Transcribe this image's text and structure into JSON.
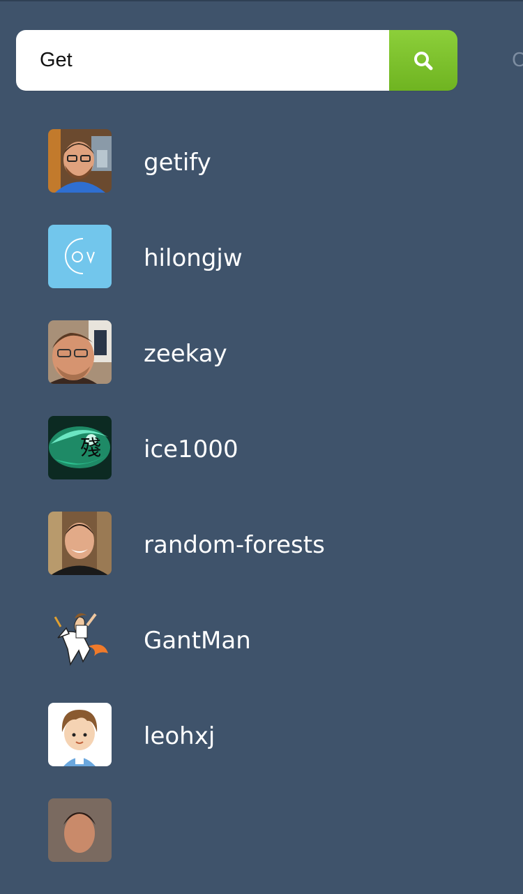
{
  "search": {
    "query": "Get",
    "button_icon": "search-icon",
    "cancel_partial": "C"
  },
  "users": [
    {
      "name": "getify",
      "avatar": "photo-man-beard-glasses"
    },
    {
      "name": "hilongjw",
      "avatar": "logo-ov-circle"
    },
    {
      "name": "zeekay",
      "avatar": "photo-man-glasses"
    },
    {
      "name": "ice1000",
      "avatar": "illustration-green-fish"
    },
    {
      "name": "random-forests",
      "avatar": "photo-man-smiling"
    },
    {
      "name": "GantMan",
      "avatar": "cartoon-unicorn-rider"
    },
    {
      "name": "leohxj",
      "avatar": "cartoon-boy"
    },
    {
      "name": "",
      "avatar": "photo-man-partial"
    }
  ],
  "colors": {
    "background": "#3f536b",
    "search_button": "#7cc12c",
    "text": "#ffffff"
  }
}
